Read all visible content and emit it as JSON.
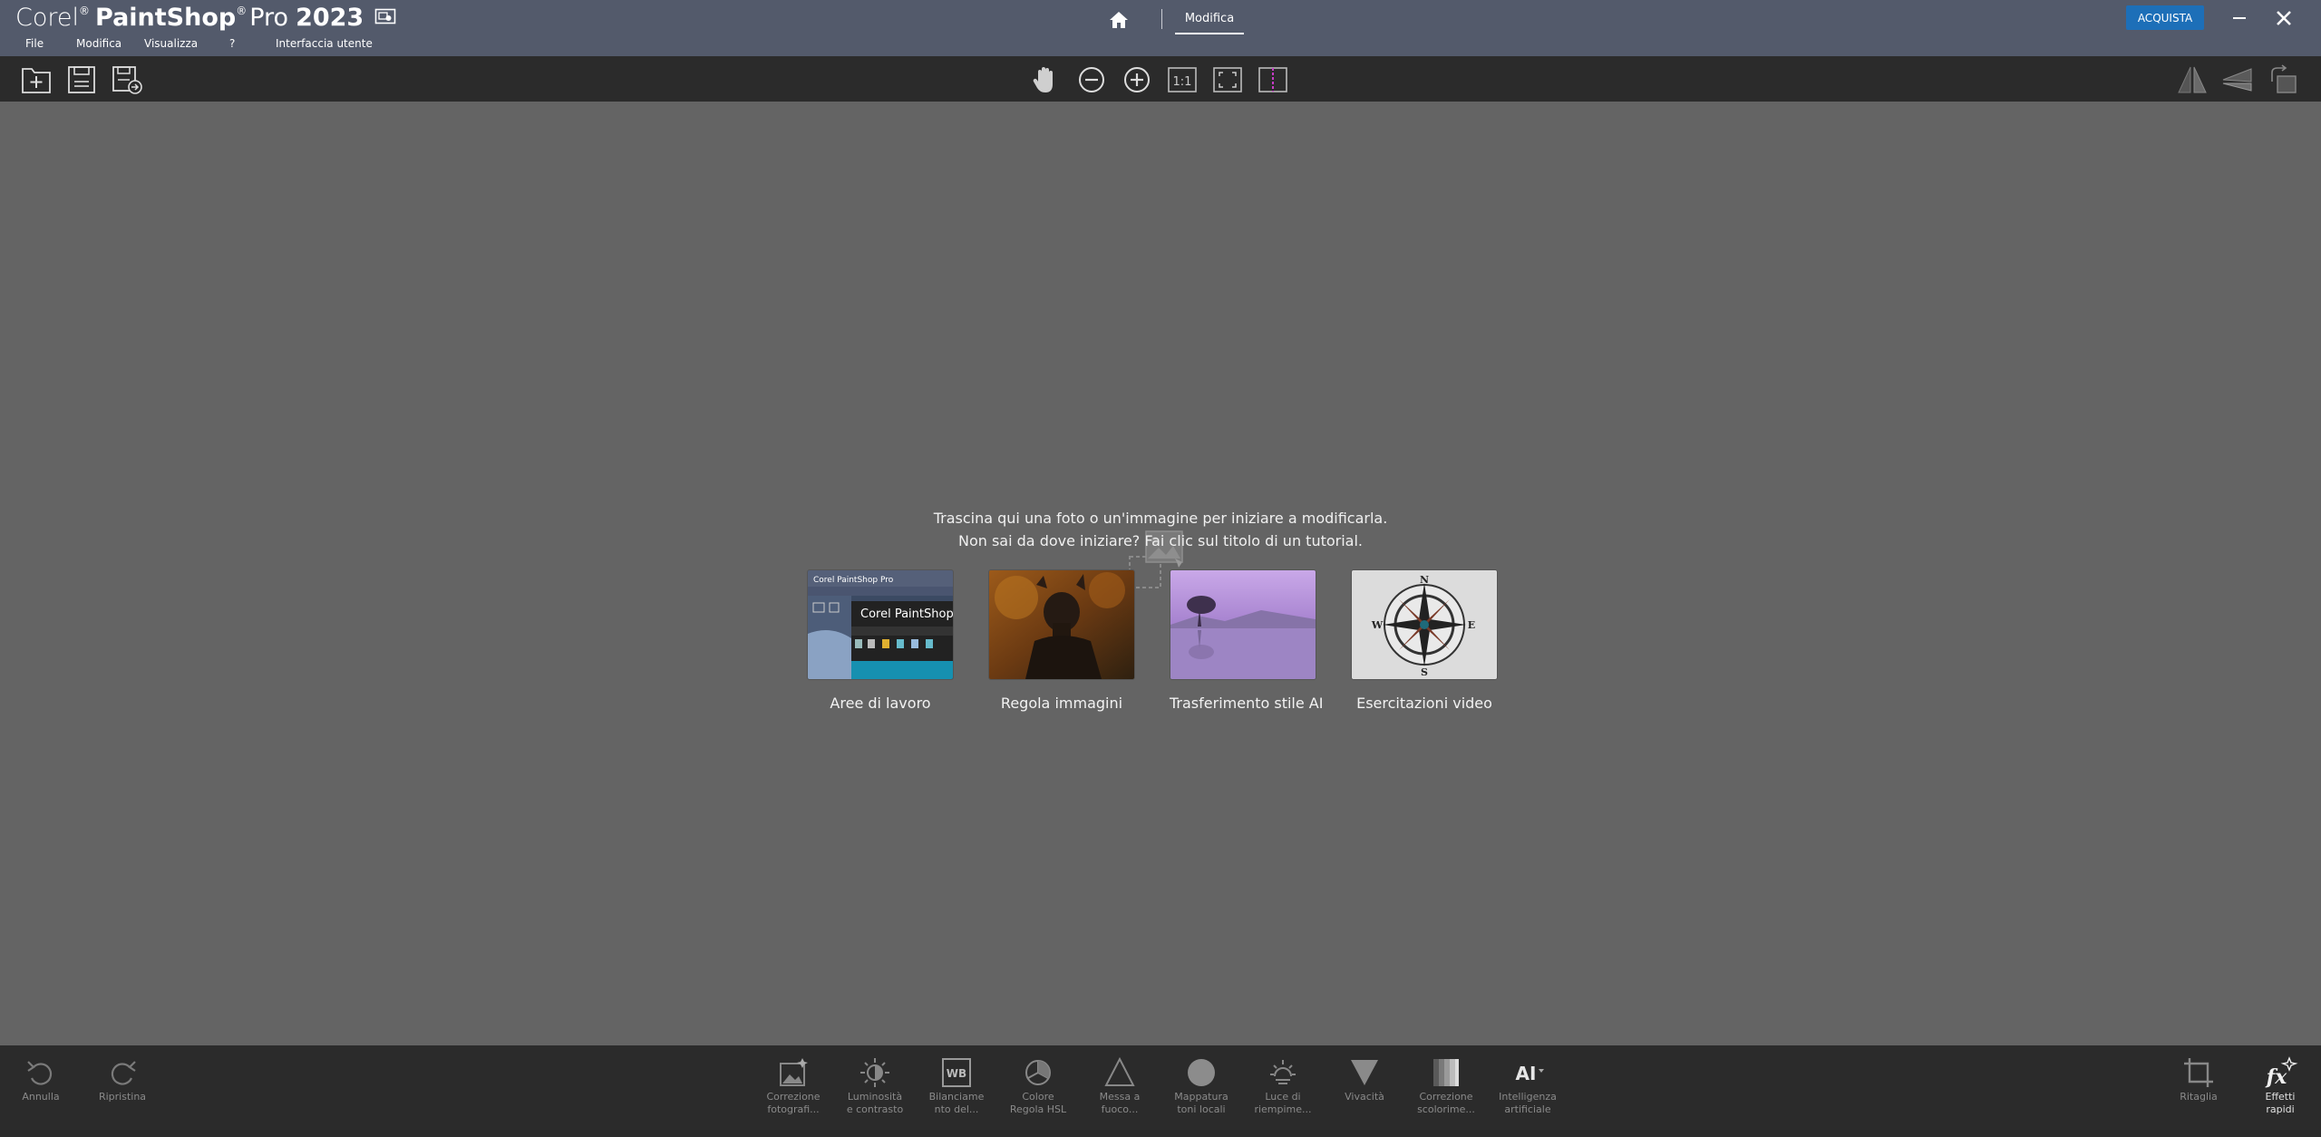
{
  "app": {
    "brand_corel": "Corel",
    "brand_reg": "®",
    "brand_paintshop": "PaintShop",
    "brand_pro": "Pro",
    "brand_year": "2023"
  },
  "menu": {
    "items": [
      "File",
      "Modifica",
      "Visualizza",
      "?",
      "Interfaccia utente"
    ]
  },
  "nav": {
    "tab_modifica": "Modifica"
  },
  "window": {
    "buy_label": "ACQUISTA"
  },
  "toolbar": {
    "left": [
      "new-icon",
      "save-icon",
      "save-as-icon"
    ],
    "center": [
      "pan-icon",
      "zoom-out-icon",
      "zoom-in-icon",
      "actual-size-icon",
      "fit-window-icon",
      "compare-icon"
    ],
    "right": [
      "flip-icon",
      "straighten-icon",
      "rotate-icon"
    ]
  },
  "workspace": {
    "drop_line1": "Trascina qui una foto o un'immagine per iniziare a modificarla.",
    "drop_line2": "Non sai da dove iniziare? Fai clic sul titolo di un tutorial.",
    "tutorials": [
      {
        "label": "Aree di lavoro",
        "thumb_text": "Corel PaintShop Pro"
      },
      {
        "label": "Regola immagini"
      },
      {
        "label": "Trasferimento stile AI"
      },
      {
        "label": "Esercitazioni video",
        "compass": [
          "N",
          "S",
          "E",
          "W"
        ]
      }
    ]
  },
  "bottombar": {
    "undo": "Annulla",
    "redo": "Ripristina",
    "tools": [
      {
        "l1": "Correzione",
        "l2": "fotografi..."
      },
      {
        "l1": "Luminosità",
        "l2": "e contrasto"
      },
      {
        "l1": "Bilanciame",
        "l2": "nto del..."
      },
      {
        "l1": "Colore",
        "l2": "Regola HSL"
      },
      {
        "l1": "Messa a",
        "l2": "fuoco..."
      },
      {
        "l1": "Mappatura",
        "l2": "toni locali"
      },
      {
        "l1": "Luce di",
        "l2": "riempime..."
      },
      {
        "l1": "Vivacità",
        "l2": ""
      },
      {
        "l1": "Correzione",
        "l2": "scolorime..."
      },
      {
        "l1": "Intelligenza",
        "l2": "artificiale"
      }
    ],
    "wb_text": "WB",
    "ai_text": "AI",
    "crop": "Ritaglia",
    "effects_l1": "Effetti",
    "effects_l2": "rapidi",
    "fx_text": "fx"
  },
  "colors": {
    "titlebar": "#535a6b",
    "toolbar": "#2b2b2b",
    "workspace": "#646464",
    "accent": "#1d6fb8",
    "compare_accent": "#c83cc8"
  }
}
